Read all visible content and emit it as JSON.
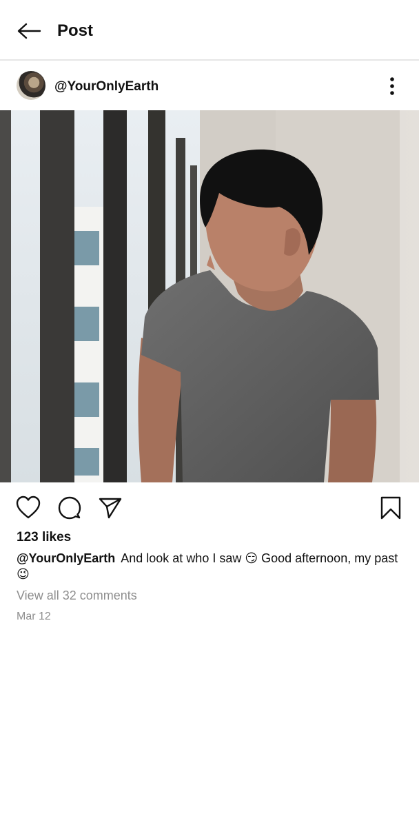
{
  "header": {
    "title": "Post",
    "back_icon": "arrow-left-icon"
  },
  "post": {
    "username": "@YourOnlyEarth",
    "avatar_icon": "avatar",
    "more_icon": "more-vertical-icon",
    "likes": "123 likes",
    "caption": {
      "username": "@YourOnlyEarth",
      "text": "And look at who I saw 😏 Good afternoon, my past 😉"
    },
    "view_comments": "View all 32 comments",
    "date": "Mar 12"
  },
  "actions": {
    "like_icon": "heart-icon",
    "comment_icon": "comment-icon",
    "share_icon": "send-icon",
    "save_icon": "bookmark-icon"
  },
  "colors": {
    "text": "#111111",
    "muted": "#8e8e8e",
    "divider": "#e6e6e6",
    "background": "#ffffff"
  }
}
